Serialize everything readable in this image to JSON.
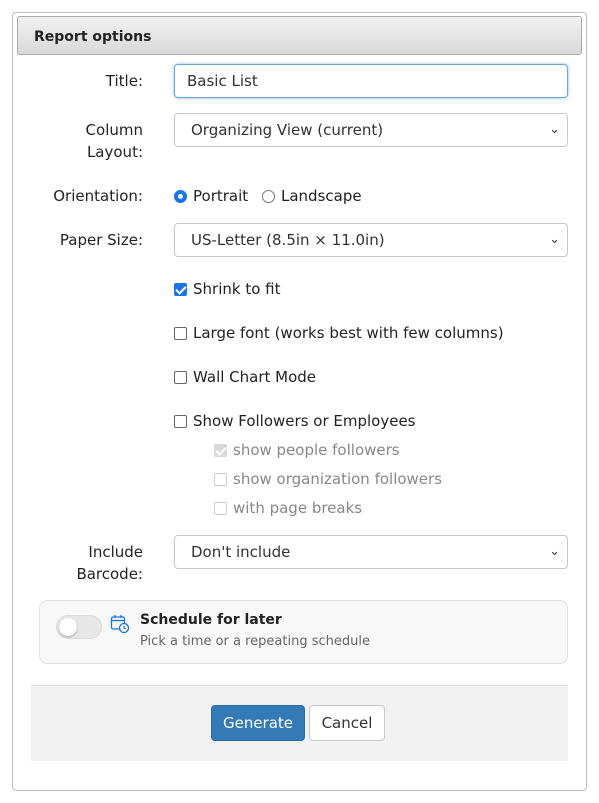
{
  "dialog": {
    "title": "Report options"
  },
  "form": {
    "title_label": "Title:",
    "title_value": "Basic List",
    "column_layout_label_line1": "Column",
    "column_layout_label_line2": "Layout:",
    "column_layout_value": "Organizing View (current)",
    "orientation_label": "Orientation:",
    "orientation_options": [
      {
        "label": "Portrait",
        "selected": true
      },
      {
        "label": "Landscape",
        "selected": false
      }
    ],
    "paper_size_label": "Paper Size:",
    "paper_size_value": "US-Letter (8.5in × 11.0in)",
    "checkboxes": [
      {
        "label": "Shrink to fit",
        "checked": true,
        "disabled": false
      },
      {
        "label": "Large font (works best with few columns)",
        "checked": false,
        "disabled": false
      },
      {
        "label": "Wall Chart Mode",
        "checked": false,
        "disabled": false
      },
      {
        "label": "Show Followers or Employees",
        "checked": false,
        "disabled": false
      }
    ],
    "sub_checkboxes": [
      {
        "label": "show people followers",
        "checked": true,
        "disabled": true
      },
      {
        "label": "show organization followers",
        "checked": false,
        "disabled": true
      },
      {
        "label": "with page breaks",
        "checked": false,
        "disabled": true
      }
    ],
    "barcode_label_line1": "Include",
    "barcode_label_line2": "Barcode:",
    "barcode_value": "Don't include"
  },
  "schedule": {
    "title": "Schedule for later",
    "subtitle": "Pick a time or a repeating schedule",
    "enabled": false,
    "icon": "calendar-clock-icon",
    "accent": "#1a73e8"
  },
  "footer": {
    "generate_label": "Generate",
    "cancel_label": "Cancel"
  }
}
